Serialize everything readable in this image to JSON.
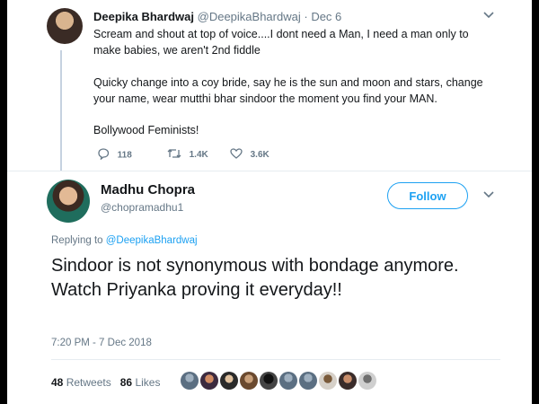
{
  "reply_tweet": {
    "name": "Deepika Bhardwaj",
    "handle": "@DeepikaBhardwaj",
    "separator": "·",
    "date": "Dec 6",
    "paragraphs": [
      "Scream and shout at top of voice....I dont need a Man, I need a man only to make babies, we aren't 2nd fiddle",
      "Quicky change into a coy bride, say he is the sun and moon and stars, change your name, wear mutthi bhar sindoor the moment you find your MAN.",
      "Bollywood Feminists!"
    ],
    "actions": {
      "replies": "118",
      "retweets": "1.4K",
      "likes": "3.6K"
    }
  },
  "main_tweet": {
    "name": "Madhu Chopra",
    "handle": "@chopramadhu1",
    "follow_label": "Follow",
    "replying_prefix": "Replying to",
    "replying_to": "@DeepikaBhardwaj",
    "text": "Sindoor is not synonymous with bondage anymore. Watch Priyanka proving it everyday!!",
    "timestamp": "7:20 PM - 7 Dec 2018",
    "retweet_count": "48",
    "retweet_label": "Retweets",
    "like_count": "86",
    "like_label": "Likes"
  },
  "icons": {
    "reply": "reply-icon",
    "retweet": "retweet-icon",
    "like": "heart-icon",
    "menu": "chevron-down-icon"
  },
  "colors": {
    "accent": "#1da1f2",
    "text": "#14171a",
    "muted": "#657786"
  }
}
